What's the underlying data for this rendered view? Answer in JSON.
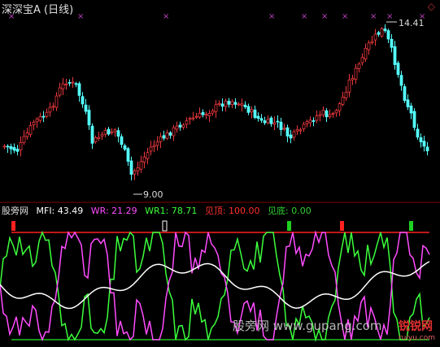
{
  "main": {
    "title": "深深宝A (日线)",
    "close_icon": "diamond-close-icon",
    "high_label": "14.41",
    "low_label": "9.00"
  },
  "indicator": {
    "source": "股旁网",
    "mfi": "MFI: 43.49",
    "wr": "WR: 21.29",
    "wr1": "WR1: 78.71",
    "top": "见顶: 100.00",
    "bottom": "见底: 0.00"
  },
  "watermark": {
    "text": "股旁网  www.gupang.com",
    "logo": "锐锐网",
    "logo_sub": "ruiyu.com"
  },
  "colors": {
    "up": "#e8383d",
    "down": "#54ffff",
    "mfi": "#ffffff",
    "wr": "#ff4cff",
    "wr1": "#3cff3c",
    "top_line": "#ff2020",
    "bottom_line": "#20c020",
    "marker": "#c040c0"
  }
}
